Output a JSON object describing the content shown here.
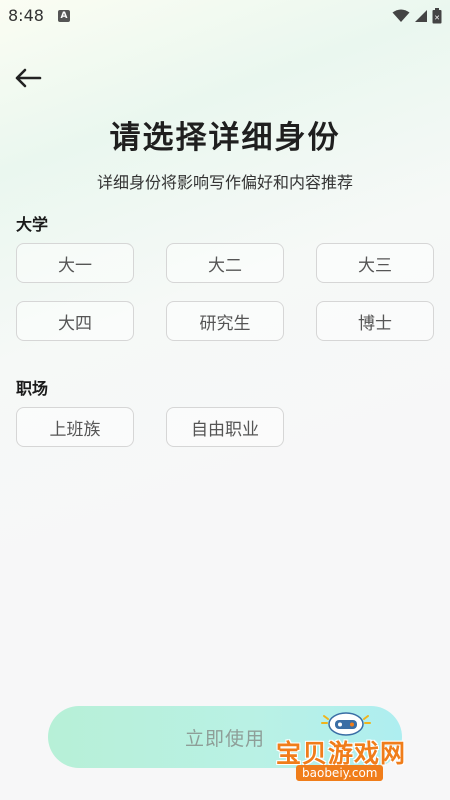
{
  "status_bar": {
    "time": "8:48",
    "app_icon_letter": "A",
    "icons": [
      "wifi-icon",
      "signal-icon",
      "battery-icon"
    ]
  },
  "header": {
    "back_icon": "arrow-left-icon",
    "title": "请选择详细身份",
    "subtitle": "详细身份将影响写作偏好和内容推荐"
  },
  "sections": {
    "university": {
      "title": "大学",
      "options": [
        "大一",
        "大二",
        "大三",
        "大四",
        "研究生",
        "博士"
      ]
    },
    "workplace": {
      "title": "职场",
      "options": [
        "上班族",
        "自由职业"
      ]
    }
  },
  "footer": {
    "submit_label": "立即使用"
  },
  "watermark": {
    "text": "宝贝游戏网",
    "url": "baobeiy.com"
  },
  "colors": {
    "button_gradient_start": "#b7f0d7",
    "button_gradient_end": "#aeeef0",
    "option_border": "#d6d6d6",
    "watermark_orange": "#f07d1a"
  }
}
